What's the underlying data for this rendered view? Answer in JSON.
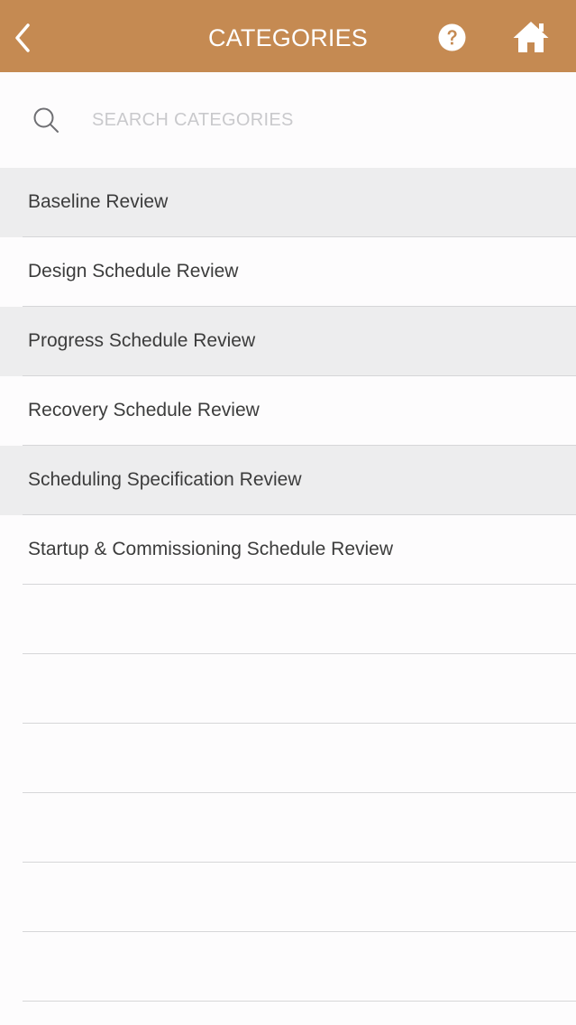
{
  "header": {
    "title": "CATEGORIES",
    "back_icon": "chevron-left-icon",
    "help_icon": "question-circle-icon",
    "home_icon": "home-icon",
    "background_color": "#c58a52"
  },
  "search": {
    "placeholder": "SEARCH CATEGORIES",
    "value": "",
    "icon": "search-icon"
  },
  "categories": [
    {
      "label": "Baseline Review"
    },
    {
      "label": "Design Schedule Review"
    },
    {
      "label": "Progress Schedule Review"
    },
    {
      "label": "Recovery Schedule Review"
    },
    {
      "label": "Scheduling Specification Review"
    },
    {
      "label": "Startup & Commissioning Schedule Review"
    }
  ]
}
